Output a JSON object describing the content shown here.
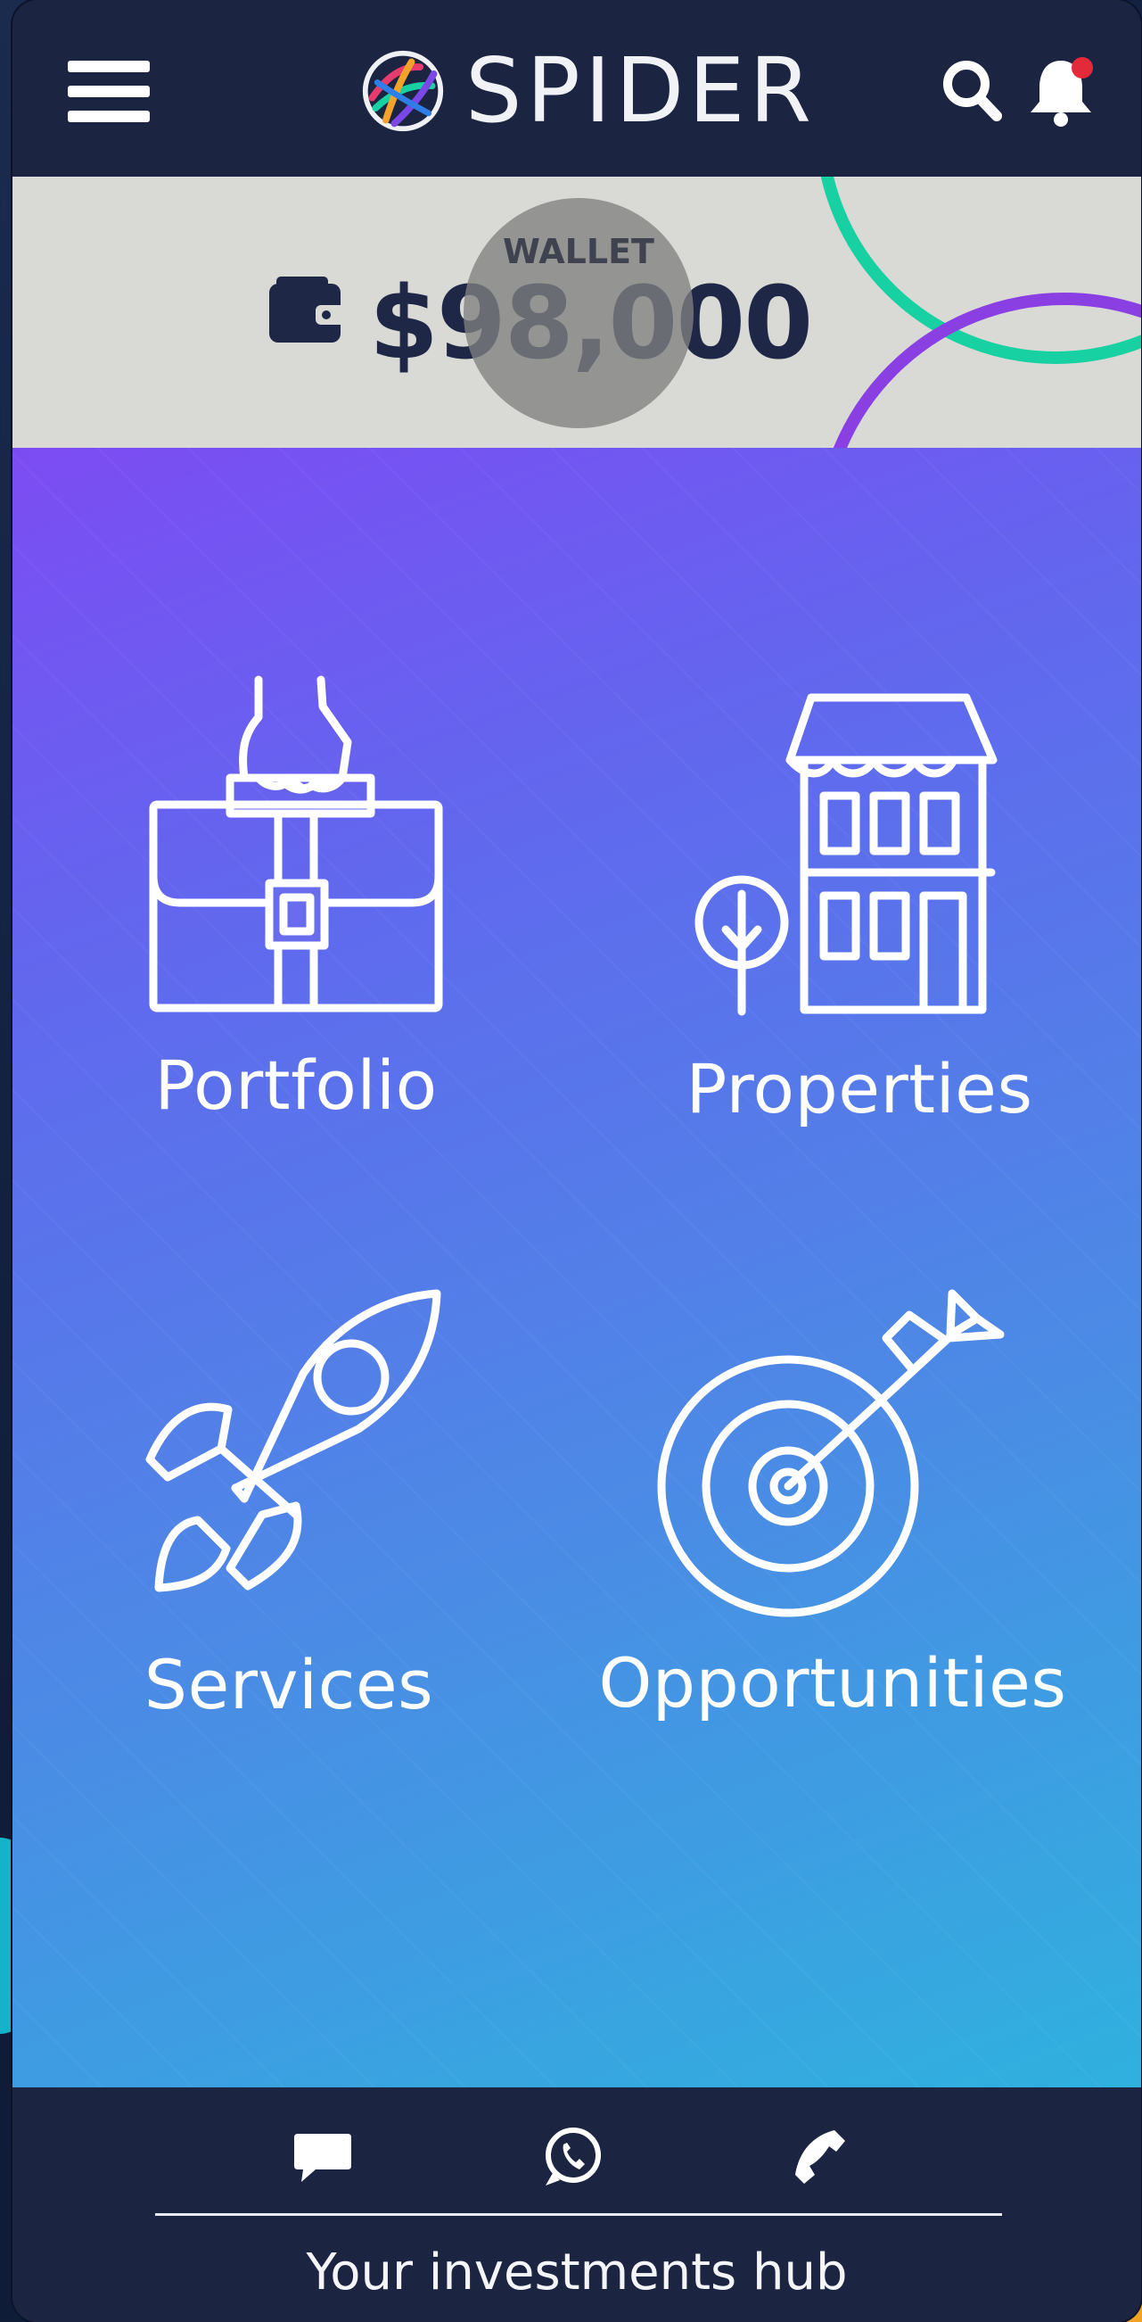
{
  "header": {
    "brand_name": "SPIDER",
    "icons": [
      "hamburger-menu-icon",
      "spider-logo-icon",
      "search-icon",
      "bell-icon"
    ],
    "notification_dot_color": "#e4293b"
  },
  "wallet": {
    "caption": "WALLET",
    "amount": "$98,000",
    "icon": "wallet-icon"
  },
  "tiles": [
    {
      "label": "Portfolio",
      "icon": "briefcase-hand-icon"
    },
    {
      "label": "Properties",
      "icon": "building-tree-icon"
    },
    {
      "label": "Services",
      "icon": "rocket-icon"
    },
    {
      "label": "Opportunities",
      "icon": "target-arrow-icon"
    }
  ],
  "footer": {
    "icons": [
      "chat-icon",
      "whatsapp-icon",
      "phone-icon"
    ],
    "tagline": "Your investments hub"
  },
  "colors": {
    "header_bg": "#1b2440",
    "wallet_bar_bg": "#d9d9d6",
    "gradient_start": "#7c4cf3",
    "gradient_end": "#2fb1de",
    "ring_green": "#18d1a3",
    "ring_purple": "#8a3fe2"
  }
}
